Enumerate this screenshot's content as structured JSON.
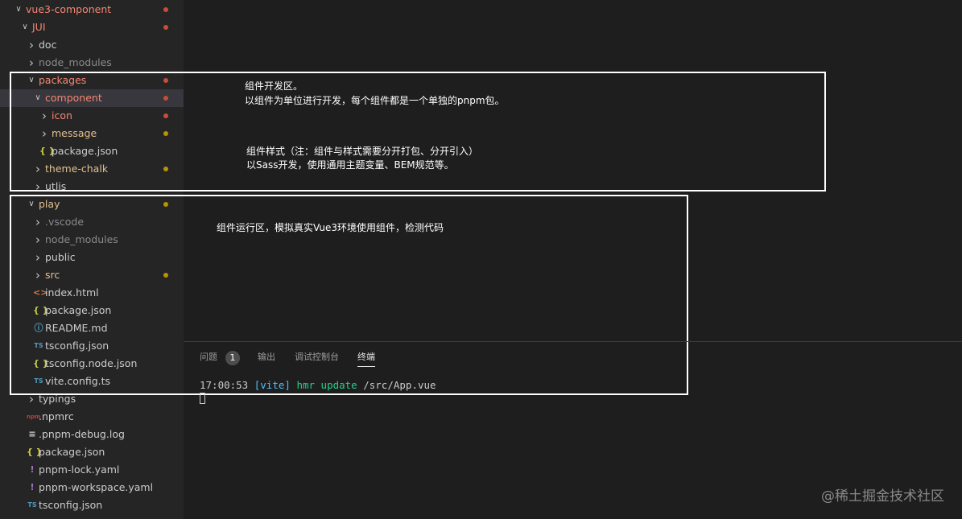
{
  "explorer": {
    "items": [
      {
        "label": "vue3-component",
        "indent": 0,
        "chevron": "down",
        "icon": "",
        "color": "red",
        "dot": "red"
      },
      {
        "label": "JUI",
        "indent": 1,
        "chevron": "down",
        "icon": "",
        "color": "red",
        "dot": "red"
      },
      {
        "label": "doc",
        "indent": 2,
        "chevron": "right",
        "icon": "",
        "color": "white",
        "dot": ""
      },
      {
        "label": "node_modules",
        "indent": 2,
        "chevron": "right",
        "icon": "",
        "color": "dim",
        "dot": ""
      },
      {
        "label": "packages",
        "indent": 2,
        "chevron": "down",
        "icon": "",
        "color": "red",
        "dot": "red"
      },
      {
        "label": "component",
        "indent": 3,
        "chevron": "down",
        "icon": "",
        "color": "red",
        "dot": "red",
        "selected": true
      },
      {
        "label": "icon",
        "indent": 4,
        "chevron": "right",
        "icon": "",
        "color": "red",
        "dot": "red"
      },
      {
        "label": "message",
        "indent": 4,
        "chevron": "right",
        "icon": "",
        "color": "yellow",
        "dot": "yellow"
      },
      {
        "label": "package.json",
        "indent": 4,
        "chevron": "",
        "icon": "{ }",
        "iconColor": "#cbcb41",
        "color": "white",
        "dot": ""
      },
      {
        "label": "theme-chalk",
        "indent": 3,
        "chevron": "right",
        "icon": "",
        "color": "yellow",
        "dot": "yellow"
      },
      {
        "label": "utlis",
        "indent": 3,
        "chevron": "right",
        "icon": "",
        "color": "white",
        "dot": ""
      },
      {
        "label": "play",
        "indent": 2,
        "chevron": "down",
        "icon": "",
        "color": "yellow",
        "dot": "yellow"
      },
      {
        "label": ".vscode",
        "indent": 3,
        "chevron": "right",
        "icon": "",
        "color": "dim",
        "dot": ""
      },
      {
        "label": "node_modules",
        "indent": 3,
        "chevron": "right",
        "icon": "",
        "color": "dim",
        "dot": ""
      },
      {
        "label": "public",
        "indent": 3,
        "chevron": "right",
        "icon": "",
        "color": "white",
        "dot": ""
      },
      {
        "label": "src",
        "indent": 3,
        "chevron": "right",
        "icon": "",
        "color": "yellow",
        "dot": "yellow"
      },
      {
        "label": "index.html",
        "indent": 3,
        "chevron": "",
        "icon": "<>",
        "iconColor": "#e37933",
        "color": "white",
        "dot": ""
      },
      {
        "label": "package.json",
        "indent": 3,
        "chevron": "",
        "icon": "{ }",
        "iconColor": "#cbcb41",
        "color": "white",
        "dot": ""
      },
      {
        "label": "README.md",
        "indent": 3,
        "chevron": "",
        "icon": "ⓘ",
        "iconColor": "#519aba",
        "color": "white",
        "dot": ""
      },
      {
        "label": "tsconfig.json",
        "indent": 3,
        "chevron": "",
        "icon": "TS",
        "iconColor": "#519aba",
        "color": "white",
        "dot": ""
      },
      {
        "label": "tsconfig.node.json",
        "indent": 3,
        "chevron": "",
        "icon": "{ }",
        "iconColor": "#cbcb41",
        "color": "white",
        "dot": ""
      },
      {
        "label": "vite.config.ts",
        "indent": 3,
        "chevron": "",
        "icon": "TS",
        "iconColor": "#519aba",
        "color": "white",
        "dot": ""
      },
      {
        "label": "typings",
        "indent": 2,
        "chevron": "right",
        "icon": "",
        "color": "white",
        "dot": ""
      },
      {
        "label": ".npmrc",
        "indent": 2,
        "chevron": "",
        "icon": "npm",
        "iconColor": "#cb3837",
        "color": "white",
        "dot": ""
      },
      {
        "label": ".pnpm-debug.log",
        "indent": 2,
        "chevron": "",
        "icon": "≡",
        "iconColor": "#cccccc",
        "color": "white",
        "dot": ""
      },
      {
        "label": "package.json",
        "indent": 2,
        "chevron": "",
        "icon": "{ }",
        "iconColor": "#cbcb41",
        "color": "white",
        "dot": ""
      },
      {
        "label": "pnpm-lock.yaml",
        "indent": 2,
        "chevron": "",
        "icon": "!",
        "iconColor": "#a074c4",
        "color": "white",
        "dot": ""
      },
      {
        "label": "pnpm-workspace.yaml",
        "indent": 2,
        "chevron": "",
        "icon": "!",
        "iconColor": "#a074c4",
        "color": "white",
        "dot": ""
      },
      {
        "label": "tsconfig.json",
        "indent": 2,
        "chevron": "",
        "icon": "TS",
        "iconColor": "#519aba",
        "color": "white",
        "dot": ""
      }
    ]
  },
  "annotations": {
    "dev_title": "组件开发区。",
    "dev_desc": "以组件为单位进行开发，每个组件都是一个单独的pnpm包。",
    "style_title": "组件样式（注：组件与样式需要分开打包、分开引入）",
    "style_desc": "以Sass开发，使用通用主题变量、BEM规范等。",
    "run_desc": "组件运行区，模拟真实Vue3环境使用组件，检测代码"
  },
  "panel": {
    "tabs": [
      "问题",
      "输出",
      "调试控制台",
      "终端"
    ],
    "active_tab": "终端",
    "problems_count": "1",
    "terminal": {
      "time": "17:00:53",
      "tag": "[vite]",
      "message": "hmr update",
      "path": "/src/App.vue"
    }
  },
  "watermark": "@稀土掘金技术社区",
  "colors": {
    "background": "#1e1e1e",
    "sidebar": "#252526",
    "modified_red": "#f48771",
    "untracked_yellow": "#e2c08d",
    "vite_blue": "#4fc1ff",
    "hmr_green": "#23d18b"
  }
}
